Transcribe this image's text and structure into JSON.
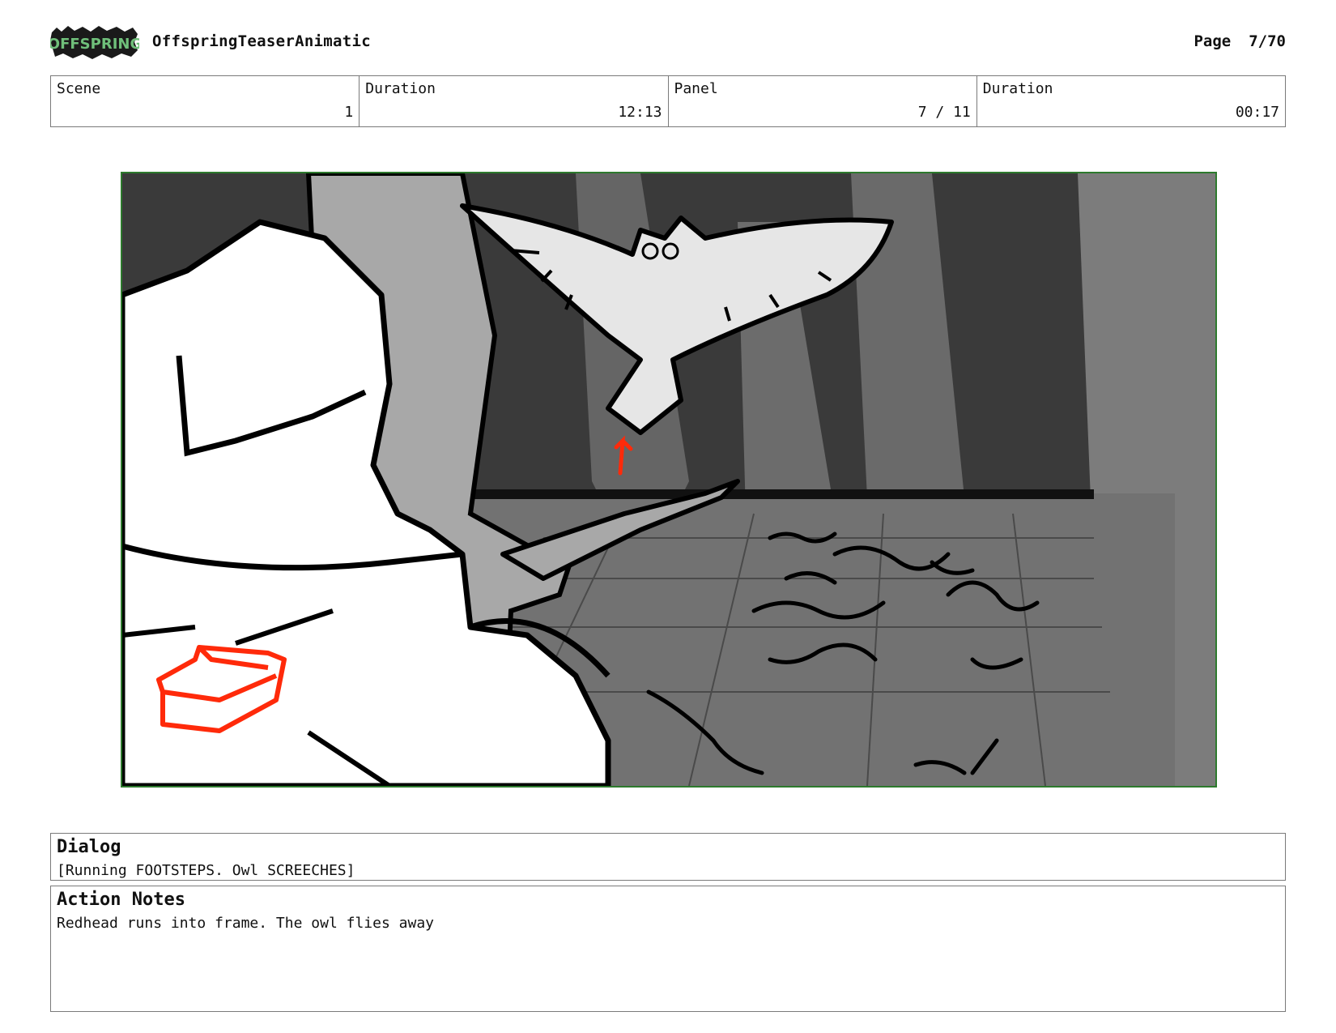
{
  "header": {
    "logo_text": "OFFSPRING",
    "project_title": "OffspringTeaserAnimatic",
    "page_label": "Page",
    "page_value": "7/70"
  },
  "info": [
    {
      "label": "Scene",
      "value": "1"
    },
    {
      "label": "Duration",
      "value": "12:13"
    },
    {
      "label": "Panel",
      "value": "7 / 11"
    },
    {
      "label": "Duration",
      "value": "00:17"
    }
  ],
  "dialog": {
    "heading": "Dialog",
    "text": "[Running FOOTSTEPS. Owl SCREECHES]"
  },
  "action_notes": {
    "heading": "Action Notes",
    "text": "Redhead runs into frame. The owl flies away"
  },
  "colors": {
    "frame_border": "#2d7a2d",
    "annotation_red": "#ff2a0a"
  }
}
